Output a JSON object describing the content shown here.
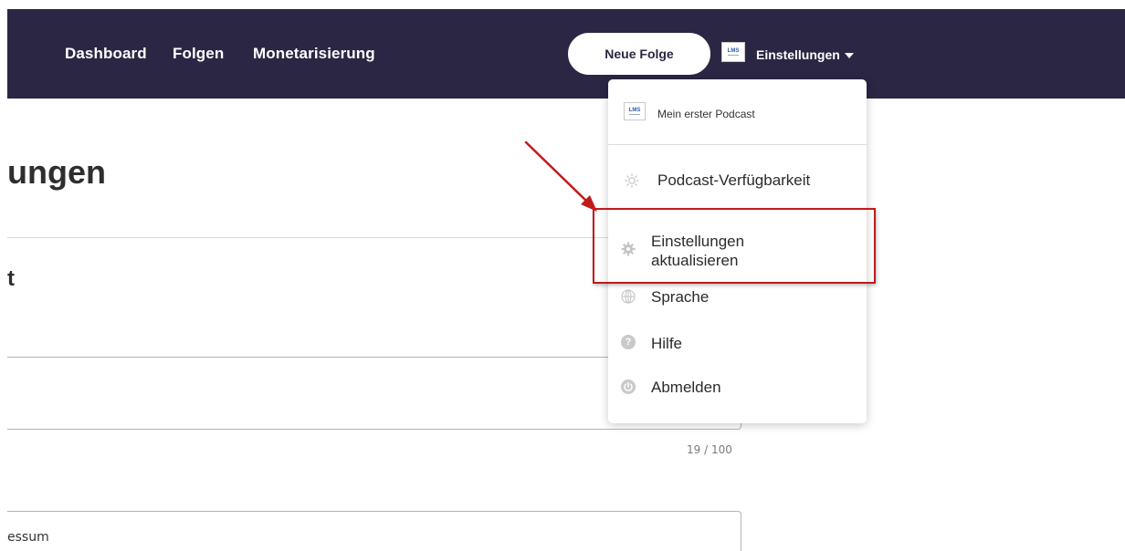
{
  "nav": {
    "links": [
      "Dashboard",
      "Folgen",
      "Monetarisierung"
    ],
    "new_episode": "Neue Folge",
    "settings": "Einstellungen",
    "logo_text": "LMS"
  },
  "page": {
    "title": "ungen",
    "section_title": "t",
    "char_counter": "19 / 100",
    "field_value": "essum"
  },
  "dropdown": {
    "podcast": "Mein erster Podcast",
    "availability": "Podcast-Verfügbarkeit",
    "update_line1": "Einstellungen",
    "update_line2": "aktualisieren",
    "language": "Sprache",
    "help": "Hilfe",
    "logout": "Abmelden"
  },
  "icons": {
    "availability": "sun-icon",
    "update": "gear-icon",
    "language": "globe-icon",
    "help": "question-icon",
    "logout": "power-icon"
  },
  "colors": {
    "topbar": "#2b2643",
    "annotation": "#c21a1a"
  }
}
